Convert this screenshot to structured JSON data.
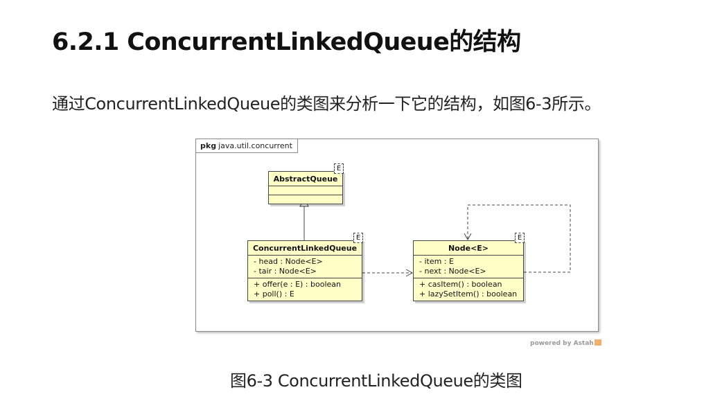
{
  "heading": "6.2.1 ConcurrentLinkedQueue的结构",
  "paragraph": "通过ConcurrentLinkedQueue的类图来分析一下它的结构，如图6-3所示。",
  "figure": {
    "package_keyword": "pkg",
    "package_name": "java.util.concurrent",
    "classes": {
      "abstract_queue": {
        "name": "AbstractQueue",
        "type_param": "E"
      },
      "concurrent_linked_queue": {
        "name": "ConcurrentLinkedQueue",
        "type_param": "E",
        "attributes": [
          "- head : Node<E>",
          "- tair : Node<E>"
        ],
        "operations": [
          "+ offer(e : E) : boolean",
          "+ poll() : E"
        ]
      },
      "node": {
        "name": "Node<E>",
        "type_param": "E",
        "attributes": [
          "- item : E",
          "- next : Node<E>"
        ],
        "operations": [
          "+ casItem() : boolean",
          "+ lazySetItem() : boolean"
        ]
      }
    },
    "watermark": "powered by Astah"
  },
  "caption": "图6-3 ConcurrentLinkedQueue的类图"
}
